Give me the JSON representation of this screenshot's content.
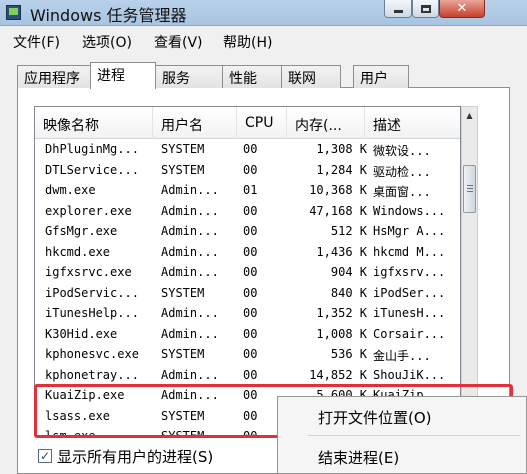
{
  "window": {
    "title": "Windows 任务管理器"
  },
  "caption": {
    "close_label": "✕"
  },
  "menu": [
    "文件(F)",
    "选项(O)",
    "查看(V)",
    "帮助(H)"
  ],
  "tabs": [
    {
      "label": "应用程序"
    },
    {
      "label": "进程",
      "active": true
    },
    {
      "label": "服务"
    },
    {
      "label": "性能"
    },
    {
      "label": "联网"
    },
    {
      "label": "用户"
    }
  ],
  "columns": [
    "映像名称",
    "用户名",
    "CPU",
    "内存(...",
    "描述"
  ],
  "processes": [
    {
      "name": "DhPluginMg...",
      "user": "SYSTEM",
      "cpu": "00",
      "mem": "1,308 K",
      "desc": "微软设..."
    },
    {
      "name": "DTLService...",
      "user": "SYSTEM",
      "cpu": "00",
      "mem": "1,284 K",
      "desc": "驱动检..."
    },
    {
      "name": "dwm.exe",
      "user": "Admin...",
      "cpu": "01",
      "mem": "10,368 K",
      "desc": "桌面窗..."
    },
    {
      "name": "explorer.exe",
      "user": "Admin...",
      "cpu": "00",
      "mem": "47,168 K",
      "desc": "Windows..."
    },
    {
      "name": "GfsMgr.exe",
      "user": "Admin...",
      "cpu": "00",
      "mem": "512 K",
      "desc": "HsMgr A..."
    },
    {
      "name": "hkcmd.exe",
      "user": "Admin...",
      "cpu": "00",
      "mem": "1,436 K",
      "desc": "hkcmd M..."
    },
    {
      "name": "igfxsrvc.exe",
      "user": "Admin...",
      "cpu": "00",
      "mem": "904 K",
      "desc": "igfxsrv..."
    },
    {
      "name": "iPodServic...",
      "user": "SYSTEM",
      "cpu": "00",
      "mem": "840 K",
      "desc": "iPodSer..."
    },
    {
      "name": "iTunesHelp...",
      "user": "Admin...",
      "cpu": "00",
      "mem": "1,352 K",
      "desc": "iTunesH..."
    },
    {
      "name": "K30Hid.exe",
      "user": "Admin...",
      "cpu": "00",
      "mem": "1,008 K",
      "desc": "Corsair..."
    },
    {
      "name": "kphonesvc.exe",
      "user": "SYSTEM",
      "cpu": "00",
      "mem": "536 K",
      "desc": "金山手..."
    },
    {
      "name": "kphonetray...",
      "user": "Admin...",
      "cpu": "00",
      "mem": "14,852 K",
      "desc": "ShouJiK..."
    },
    {
      "name": "KuaiZip.exe",
      "user": "Admin...",
      "cpu": "00",
      "mem": "5,600 K",
      "desc": "KuaiZip..."
    },
    {
      "name": "lsass.exe",
      "user": "SYSTEM",
      "cpu": "00",
      "mem": "",
      "desc": ""
    },
    {
      "name": "lsm.exe",
      "user": "SYSTEM",
      "cpu": "00",
      "mem": "",
      "desc": ""
    }
  ],
  "context_menu": [
    "打开文件位置(O)",
    "结束进程(E)"
  ],
  "show_all": {
    "label": "显示所有用户的进程(S)",
    "checked": "✓"
  }
}
